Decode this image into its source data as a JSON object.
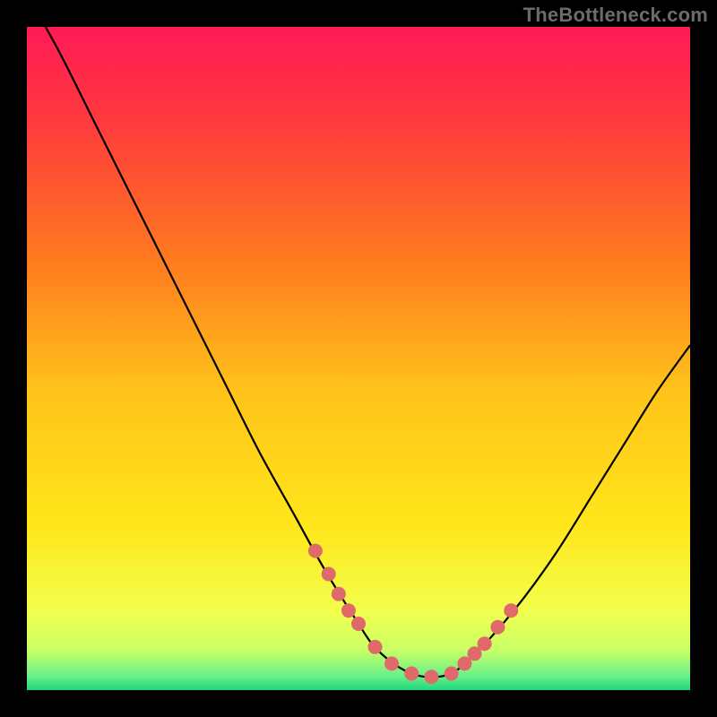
{
  "watermark": "TheBottleneck.com",
  "chart_data": {
    "type": "line",
    "title": "",
    "xlabel": "",
    "ylabel": "",
    "xlim": [
      0,
      100
    ],
    "ylim": [
      0,
      100
    ],
    "grid": false,
    "legend": false,
    "series": [
      {
        "name": "curve",
        "x": [
          0,
          5,
          10,
          15,
          20,
          25,
          30,
          35,
          40,
          45,
          50,
          52,
          54,
          56,
          58,
          60,
          62,
          64,
          66,
          70,
          75,
          80,
          85,
          90,
          95,
          100
        ],
        "y": [
          105,
          96,
          86,
          76,
          66,
          56,
          46,
          36,
          27,
          18,
          10,
          7,
          5,
          3.5,
          2.5,
          2,
          2,
          2.5,
          4,
          8,
          14,
          21,
          29,
          37,
          45,
          52
        ]
      }
    ],
    "highlighted_points": {
      "name": "dots",
      "x": [
        43.5,
        45.5,
        47,
        48.5,
        50,
        52.5,
        55,
        58,
        61,
        64,
        66,
        67.5,
        69,
        71,
        73
      ],
      "y": [
        21,
        17.5,
        14.5,
        12,
        10,
        6.5,
        4,
        2.5,
        2,
        2.5,
        4,
        5.5,
        7,
        9.5,
        12
      ]
    },
    "gradient_stops": [
      {
        "offset": 0.0,
        "color": "#ff1a56"
      },
      {
        "offset": 0.15,
        "color": "#ff3c3c"
      },
      {
        "offset": 0.35,
        "color": "#ff7a1f"
      },
      {
        "offset": 0.55,
        "color": "#ffc31a"
      },
      {
        "offset": 0.75,
        "color": "#ffe61a"
      },
      {
        "offset": 0.88,
        "color": "#f2ff4d"
      },
      {
        "offset": 0.94,
        "color": "#c8ff66"
      },
      {
        "offset": 0.98,
        "color": "#66f08a"
      },
      {
        "offset": 1.0,
        "color": "#1fd67a"
      }
    ],
    "curve_color": "#000000",
    "dot_color": "#e06a6a",
    "dot_radius_px": 8
  }
}
